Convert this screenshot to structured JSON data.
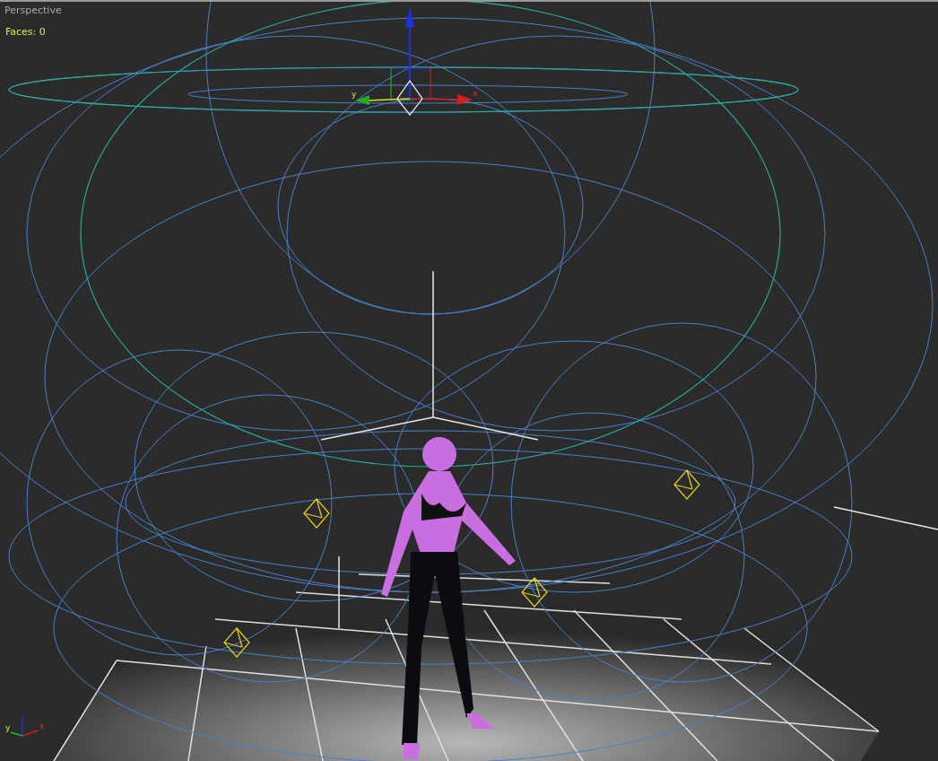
{
  "viewport": {
    "label": "Perspective",
    "stats": "Faces: 0"
  },
  "move_gizmo": {
    "labels": [
      "y",
      "x"
    ]
  },
  "axis_tripod": {
    "labels": [
      "y",
      "x"
    ]
  }
}
